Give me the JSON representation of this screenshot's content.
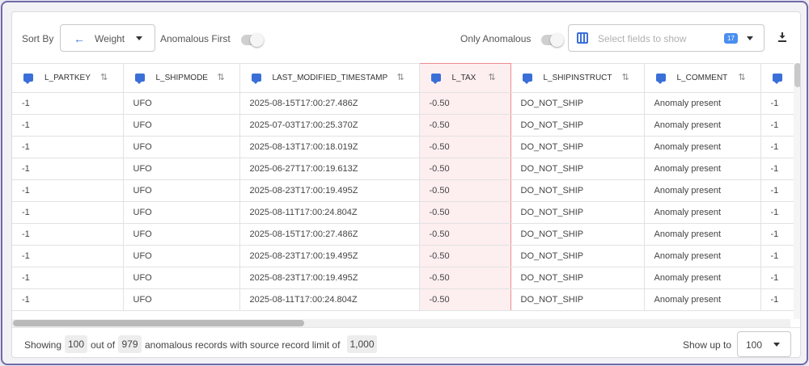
{
  "toolbar": {
    "sort_by_label": "Sort By",
    "sort_value": "Weight",
    "anomalous_first_label": "Anomalous First",
    "only_anomalous_label": "Only Anomalous",
    "fields_placeholder": "Select fields to show",
    "fields_count": "17"
  },
  "table": {
    "columns": [
      "L_PARTKEY",
      "L_SHIPMODE",
      "LAST_MODIFIED_TIMESTAMP",
      "L_TAX",
      "L_SHIPINSTRUCT",
      "L_COMMENT",
      ""
    ],
    "highlighted_column": "L_TAX",
    "rows": [
      [
        "-1",
        "UFO",
        "2025-08-15T17:00:27.486Z",
        "-0.50",
        "DO_NOT_SHIP",
        "Anomaly present",
        "-1"
      ],
      [
        "-1",
        "UFO",
        "2025-07-03T17:00:25.370Z",
        "-0.50",
        "DO_NOT_SHIP",
        "Anomaly present",
        "-1"
      ],
      [
        "-1",
        "UFO",
        "2025-08-13T17:00:18.019Z",
        "-0.50",
        "DO_NOT_SHIP",
        "Anomaly present",
        "-1"
      ],
      [
        "-1",
        "UFO",
        "2025-06-27T17:00:19.613Z",
        "-0.50",
        "DO_NOT_SHIP",
        "Anomaly present",
        "-1"
      ],
      [
        "-1",
        "UFO",
        "2025-08-23T17:00:19.495Z",
        "-0.50",
        "DO_NOT_SHIP",
        "Anomaly present",
        "-1"
      ],
      [
        "-1",
        "UFO",
        "2025-08-11T17:00:24.804Z",
        "-0.50",
        "DO_NOT_SHIP",
        "Anomaly present",
        "-1"
      ],
      [
        "-1",
        "UFO",
        "2025-08-15T17:00:27.486Z",
        "-0.50",
        "DO_NOT_SHIP",
        "Anomaly present",
        "-1"
      ],
      [
        "-1",
        "UFO",
        "2025-08-23T17:00:19.495Z",
        "-0.50",
        "DO_NOT_SHIP",
        "Anomaly present",
        "-1"
      ],
      [
        "-1",
        "UFO",
        "2025-08-23T17:00:19.495Z",
        "-0.50",
        "DO_NOT_SHIP",
        "Anomaly present",
        "-1"
      ],
      [
        "-1",
        "UFO",
        "2025-08-11T17:00:24.804Z",
        "-0.50",
        "DO_NOT_SHIP",
        "Anomaly present",
        "-1"
      ]
    ]
  },
  "footer": {
    "showing_label": "Showing",
    "shown_count": "100",
    "out_of_label": "out of",
    "total_count": "979",
    "records_label": "anomalous records with source record limit of",
    "source_limit": "1,000",
    "show_up_to_label": "Show up to",
    "show_up_to_value": "100"
  },
  "colors": {
    "accent": "#3b6fd8",
    "highlight_bg": "#fdeef0",
    "highlight_border": "#ef8a92"
  }
}
